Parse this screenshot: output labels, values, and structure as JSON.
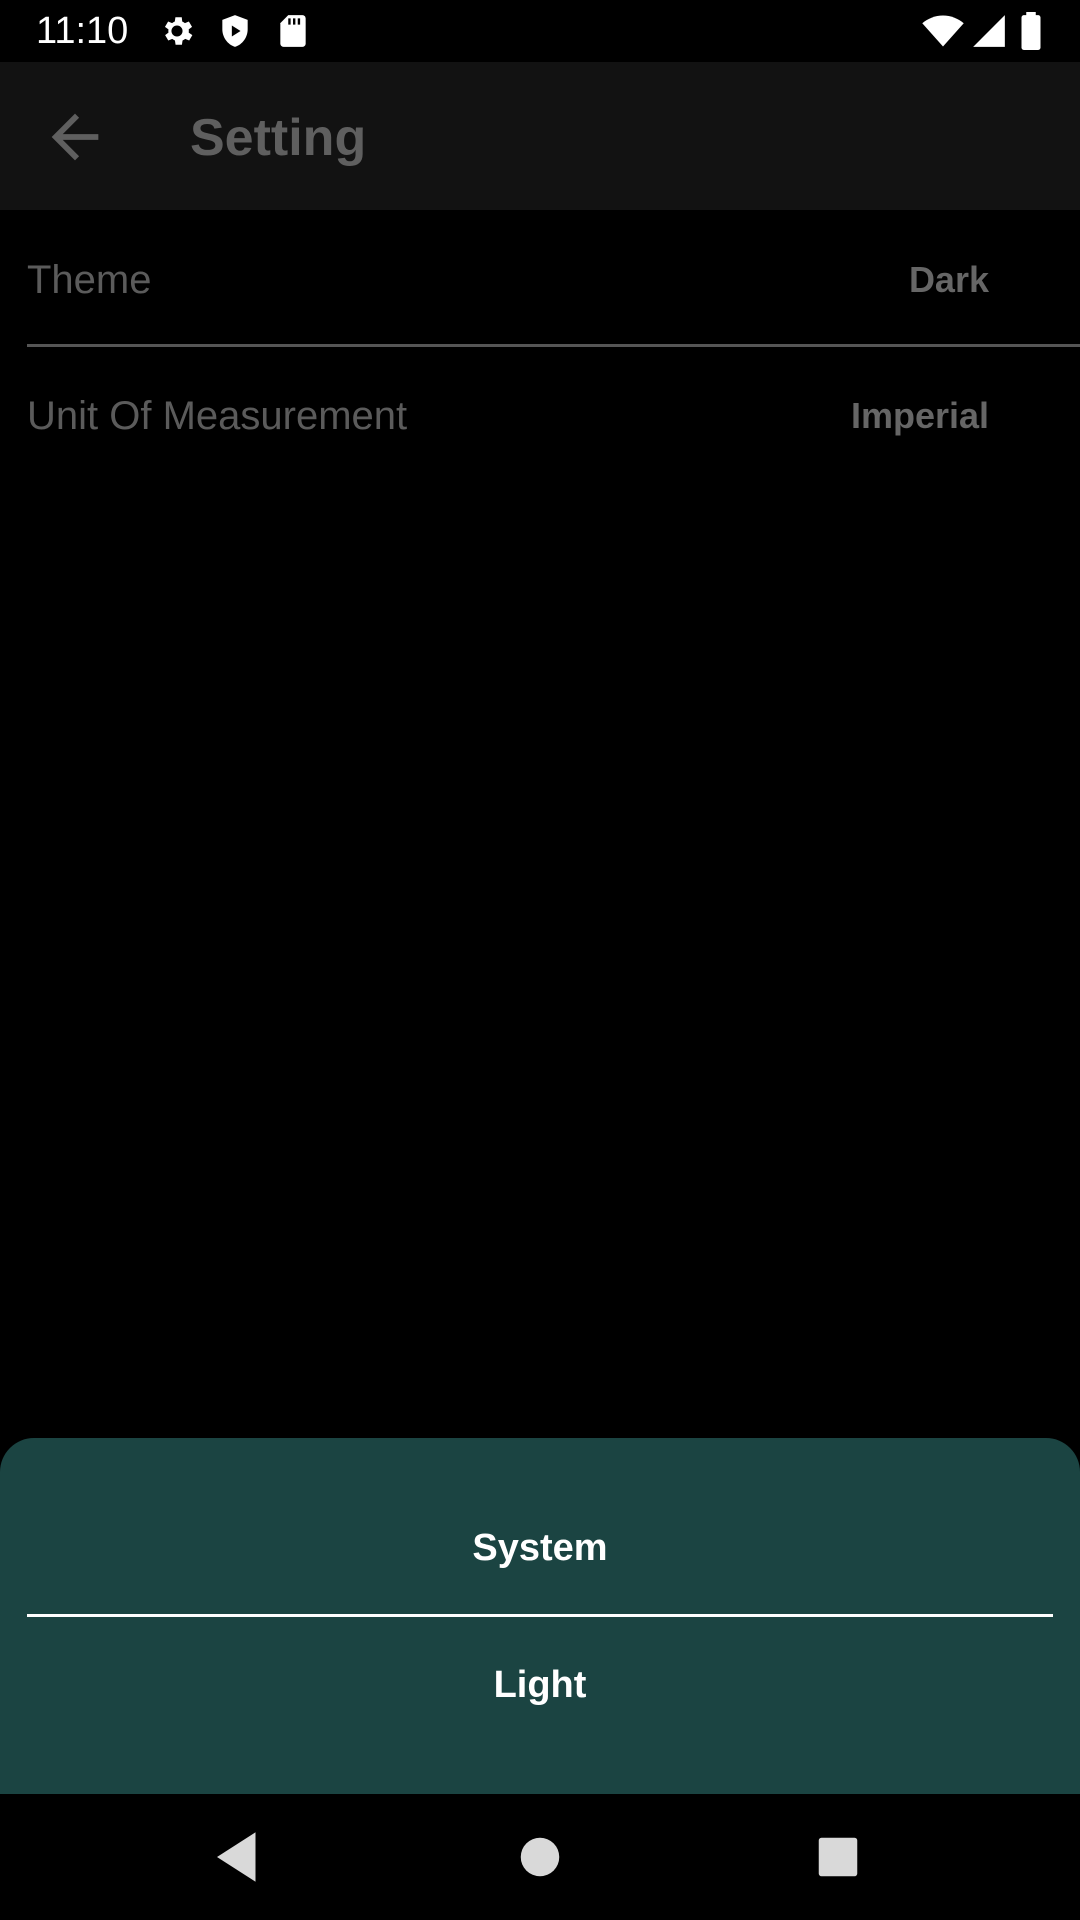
{
  "status_bar": {
    "time": "11:10",
    "icons": [
      "gear-icon",
      "shield-icon",
      "sd-card-icon",
      "wifi-icon",
      "cell-signal-icon",
      "battery-icon"
    ]
  },
  "app_bar": {
    "title": "Setting",
    "back_icon": "arrow-back-icon"
  },
  "settings": {
    "rows": [
      {
        "label": "Theme",
        "value": "Dark"
      },
      {
        "label": "Unit Of Measurement",
        "value": "Imperial"
      }
    ]
  },
  "bottom_sheet": {
    "options": [
      "System",
      "Light"
    ],
    "background_color": "#1b4442"
  },
  "nav_bar": {
    "buttons": [
      "back-triangle-icon",
      "home-circle-icon",
      "recents-square-icon"
    ]
  }
}
